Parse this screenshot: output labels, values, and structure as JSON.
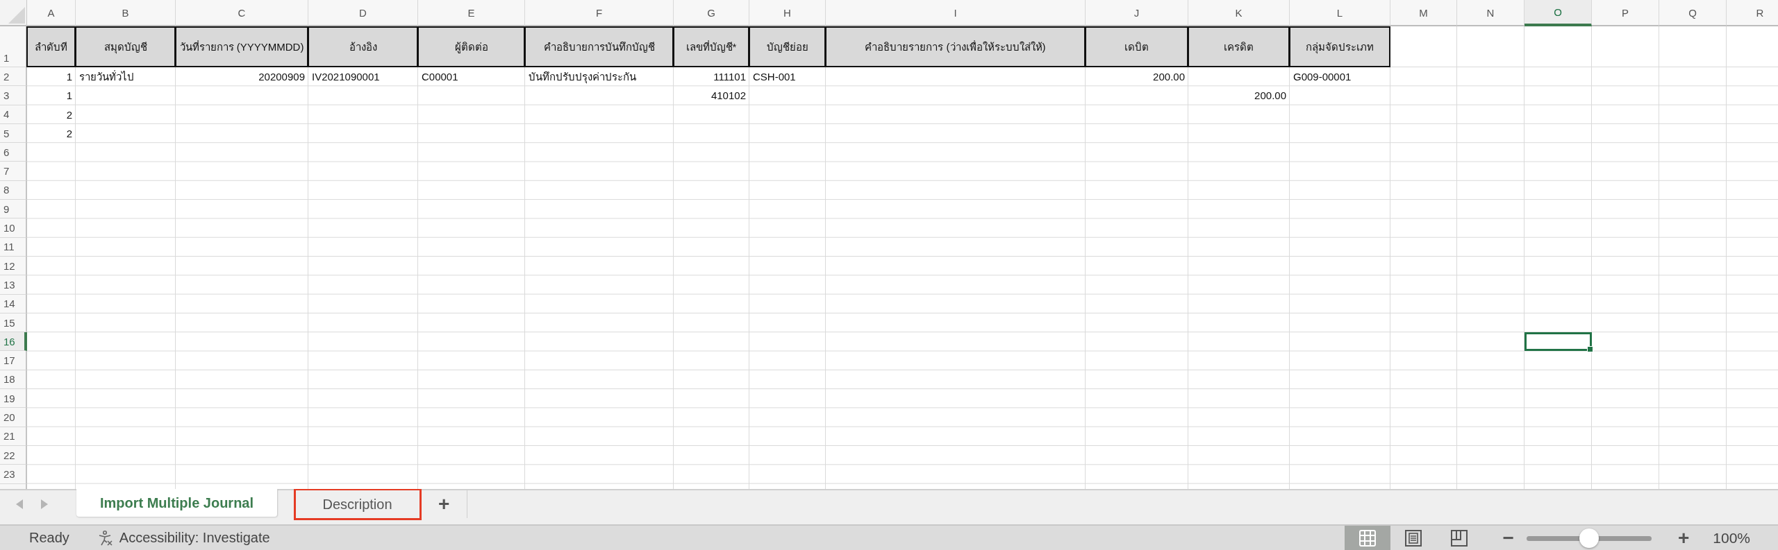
{
  "columns": [
    {
      "label": "A",
      "selected": false,
      "kind": "number"
    },
    {
      "label": "B",
      "selected": false,
      "kind": "text"
    },
    {
      "label": "C",
      "selected": false,
      "kind": "number"
    },
    {
      "label": "D",
      "selected": false,
      "kind": "text"
    },
    {
      "label": "E",
      "selected": false,
      "kind": "text"
    },
    {
      "label": "F",
      "selected": false,
      "kind": "text"
    },
    {
      "label": "G",
      "selected": false,
      "kind": "number"
    },
    {
      "label": "H",
      "selected": false,
      "kind": "text"
    },
    {
      "label": "I",
      "selected": false
    },
    {
      "label": "J",
      "selected": false,
      "kind": "number"
    },
    {
      "label": "K",
      "selected": false,
      "kind": "number"
    },
    {
      "label": "L",
      "selected": false,
      "kind": "text"
    },
    {
      "label": "M",
      "selected": false
    },
    {
      "label": "N",
      "selected": false
    },
    {
      "label": "O",
      "selected": true
    },
    {
      "label": "P",
      "selected": false
    },
    {
      "label": "Q",
      "selected": false
    },
    {
      "label": "R",
      "selected": false
    }
  ],
  "rows": [
    {
      "label": "1",
      "selected": false,
      "kind": "header",
      "cells": [
        "ลำดับที",
        "สมุดบัญชี",
        "วันที่รายการ (YYYYMMDD)",
        "อ้างอิง",
        "ผู้ติดต่อ",
        "คำอธิบายการบันทึกบัญชี",
        "เลขที่บัญชี*",
        "บัญชีย่อย",
        "คำอธิบายรายการ (ว่างเพื่อให้ระบบใส่ให้)",
        "เดบิต",
        "เครดิต",
        "กลุ่มจัดประเภท"
      ]
    },
    {
      "label": "2",
      "selected": false,
      "kind": "data",
      "cells": [
        "1",
        "รายวันทั่วไป",
        "20200909",
        "IV2021090001",
        "C00001",
        "บันทึกปรับปรุงค่าประกัน",
        "111101",
        "CSH-001",
        null,
        "200.00",
        null,
        "G009-00001"
      ]
    },
    {
      "label": "3",
      "selected": false,
      "kind": "data",
      "cells": [
        "1",
        null,
        null,
        null,
        null,
        null,
        "410102",
        null,
        null,
        null,
        "200.00",
        null
      ]
    },
    {
      "label": "4",
      "selected": false,
      "kind": "data",
      "cells": [
        "2",
        null,
        null,
        null,
        null,
        null,
        null,
        null,
        null,
        null,
        null,
        null
      ]
    },
    {
      "label": "5",
      "selected": false,
      "kind": "data",
      "cells": [
        "2",
        null,
        null,
        null,
        null,
        null,
        null,
        null,
        null,
        null,
        null,
        null
      ]
    },
    {
      "label": "6",
      "selected": false
    },
    {
      "label": "7",
      "selected": false
    },
    {
      "label": "8",
      "selected": false
    },
    {
      "label": "9",
      "selected": false
    },
    {
      "label": "10",
      "selected": false
    },
    {
      "label": "11",
      "selected": false
    },
    {
      "label": "12",
      "selected": false
    },
    {
      "label": "13",
      "selected": false
    },
    {
      "label": "14",
      "selected": false
    },
    {
      "label": "15",
      "selected": false
    },
    {
      "label": "16",
      "selected": true
    },
    {
      "label": "17",
      "selected": false
    },
    {
      "label": "18",
      "selected": false
    },
    {
      "label": "19",
      "selected": false
    },
    {
      "label": "20",
      "selected": false
    },
    {
      "label": "21",
      "selected": false
    },
    {
      "label": "22",
      "selected": false
    },
    {
      "label": "23",
      "selected": false
    }
  ],
  "sheet_tabs": [
    {
      "label": "Import Multiple Journal",
      "selected": true,
      "highlighted": false
    },
    {
      "label": "Description",
      "selected": false,
      "highlighted": true
    }
  ],
  "add_sheet": "+",
  "status_bar": {
    "status": "Ready",
    "accessibility": "Accessibility: Investigate",
    "views": [
      {
        "kind": "normal",
        "selected": true
      },
      {
        "kind": "page-layout",
        "selected": false
      },
      {
        "kind": "page-break",
        "selected": false
      }
    ],
    "zoom_out": "−",
    "zoom_in": "+",
    "zoom": {
      "level": 0.5
    },
    "zoom_reading": "100%"
  }
}
